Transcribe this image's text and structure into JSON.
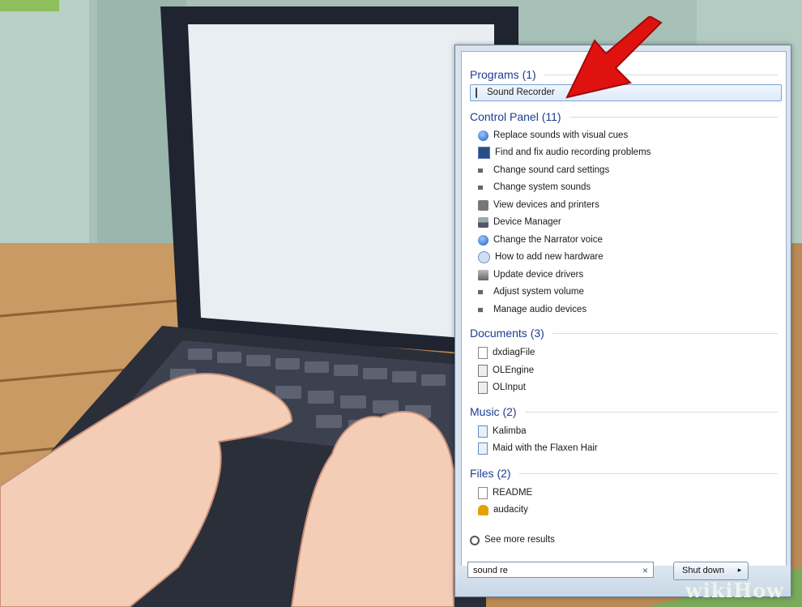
{
  "results": {
    "programs": {
      "header": "Programs (1)",
      "items": [
        {
          "label": "Sound Recorder",
          "icon": "microphone-icon"
        }
      ]
    },
    "control_panel": {
      "header": "Control Panel (11)",
      "items": [
        {
          "label": "Replace sounds with visual cues",
          "icon": "ease-of-access-icon"
        },
        {
          "label": "Find and fix audio recording problems",
          "icon": "troubleshoot-icon"
        },
        {
          "label": "Change sound card settings",
          "icon": "speaker-icon"
        },
        {
          "label": "Change system sounds",
          "icon": "speaker-icon"
        },
        {
          "label": "View devices and printers",
          "icon": "printer-icon"
        },
        {
          "label": "Device Manager",
          "icon": "device-manager-icon"
        },
        {
          "label": "Change the Narrator voice",
          "icon": "ease-of-access-icon"
        },
        {
          "label": "How to add new hardware",
          "icon": "help-icon"
        },
        {
          "label": "Update device drivers",
          "icon": "drivers-icon"
        },
        {
          "label": "Adjust system volume",
          "icon": "speaker-icon"
        },
        {
          "label": "Manage audio devices",
          "icon": "speaker-icon"
        }
      ]
    },
    "documents": {
      "header": "Documents (3)",
      "items": [
        {
          "label": "dxdiagFile",
          "icon": "document-icon"
        },
        {
          "label": "OLEngine",
          "icon": "settings-file-icon"
        },
        {
          "label": "OLInput",
          "icon": "settings-file-icon"
        }
      ]
    },
    "music": {
      "header": "Music (2)",
      "items": [
        {
          "label": "Kalimba",
          "icon": "music-file-icon"
        },
        {
          "label": "Maid with the Flaxen Hair",
          "icon": "music-file-icon"
        }
      ]
    },
    "files": {
      "header": "Files (2)",
      "items": [
        {
          "label": "README",
          "icon": "document-icon"
        },
        {
          "label": "audacity",
          "icon": "audacity-icon"
        }
      ]
    },
    "see_more": "See more results"
  },
  "search": {
    "value": "sound re",
    "clear_glyph": "×"
  },
  "shutdown": {
    "label": "Shut down",
    "arrow": "▸"
  },
  "watermark": "wikiHow",
  "colors": {
    "group_header": "#1e3d8f",
    "highlight_border": "#7da2ce",
    "arrow": "#e0120f"
  }
}
